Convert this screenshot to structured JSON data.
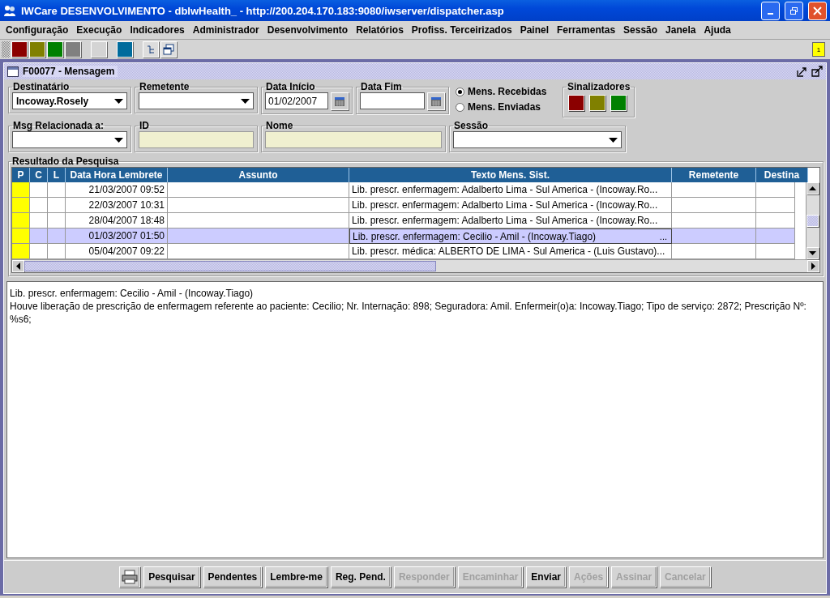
{
  "window": {
    "title": "IWCare DESENVOLVIMENTO - dbIwHealth_ - http://200.204.170.183:9080/iwserver/dispatcher.asp"
  },
  "menu": [
    "Configuração",
    "Execução",
    "Indicadores",
    "Administrador",
    "Desenvolvimento",
    "Relatórios",
    "Profiss. Terceirizados",
    "Painel",
    "Ferramentas",
    "Sessão",
    "Janela",
    "Ajuda"
  ],
  "toolbar": {
    "swatches": [
      {
        "color": "#8b0000"
      },
      {
        "color": "#808000"
      },
      {
        "color": "#008000"
      },
      {
        "color": "#808080"
      },
      {
        "color": "#d4d4d4"
      },
      {
        "color": "#006b9c"
      }
    ],
    "notification_count": "1"
  },
  "frame": {
    "title": "F00077 - Mensagem"
  },
  "filters": {
    "destinatario": {
      "label": "Destinatário",
      "value": "Incoway.Rosely"
    },
    "remetente": {
      "label": "Remetente"
    },
    "data_inicio": {
      "label": "Data Início",
      "value": "01/02/2007"
    },
    "data_fim": {
      "label": "Data Fim"
    },
    "message_type": [
      {
        "label": "Mens. Recebidas",
        "selected": true
      },
      {
        "label": "Mens. Enviadas",
        "selected": false
      }
    ],
    "sinalizadores": {
      "label": "Sinalizadores",
      "colors": [
        {
          "color": "#8b0000"
        },
        {
          "color": "#808000"
        },
        {
          "color": "#008000"
        }
      ]
    },
    "msg_relacionada": {
      "label": "Msg Relacionada a:"
    },
    "id": {
      "label": "ID"
    },
    "nome": {
      "label": "Nome"
    },
    "sessao": {
      "label": "Sessão"
    }
  },
  "results": {
    "title": "Resultado da Pesquisa",
    "columns": [
      "P",
      "C",
      "L",
      "Data Hora Lembrete",
      "Assunto",
      "Texto Mens. Sist.",
      "Remetente",
      "Destina"
    ],
    "cell_button": "...",
    "rows": [
      {
        "pending": true,
        "date": "21/03/2007 09:52",
        "text": "Lib. prescr. enfermagem: Adalberto Lima - Sul America - (Incoway.Ro...",
        "selected": false
      },
      {
        "pending": true,
        "date": "22/03/2007 10:31",
        "text": "Lib. prescr. enfermagem: Adalberto Lima - Sul America - (Incoway.Ro...",
        "selected": false
      },
      {
        "pending": true,
        "date": "28/04/2007 18:48",
        "text": "Lib. prescr. enfermagem: Adalberto Lima - Sul America - (Incoway.Ro...",
        "selected": false
      },
      {
        "pending": true,
        "date": "01/03/2007 01:50",
        "text": "Lib. prescr. enfermagem: Cecilio - Amil - (Incoway.Tiago)",
        "selected": true
      },
      {
        "pending": true,
        "date": "05/04/2007 09:22",
        "text": "Lib. prescr. médica: ALBERTO DE LIMA - Sul America - (Luis Gustavo)...",
        "selected": false
      }
    ]
  },
  "message_body": [
    "Lib. prescr. enfermagem: Cecilio - Amil - (Incoway.Tiago)",
    "Houve liberação de prescrição de enfermagem referente ao paciente: Cecilio; Nr. Internação: 898; Seguradora: Amil. Enfermeir(o)a: Incoway.Tiago; Tipo de serviço: 2872; Prescrição Nº: %s6;"
  ],
  "buttons": [
    {
      "label": "Pesquisar",
      "disabled": false
    },
    {
      "label": "Pendentes",
      "disabled": false
    },
    {
      "label": "Lembre-me",
      "disabled": false
    },
    {
      "label": "Reg. Pend.",
      "disabled": false
    },
    {
      "label": "Responder",
      "disabled": true
    },
    {
      "label": "Encaminhar",
      "disabled": true
    },
    {
      "label": "Enviar",
      "disabled": false
    },
    {
      "label": "Ações",
      "disabled": true
    },
    {
      "label": "Assinar",
      "disabled": true
    },
    {
      "label": "Cancelar",
      "disabled": true
    }
  ]
}
